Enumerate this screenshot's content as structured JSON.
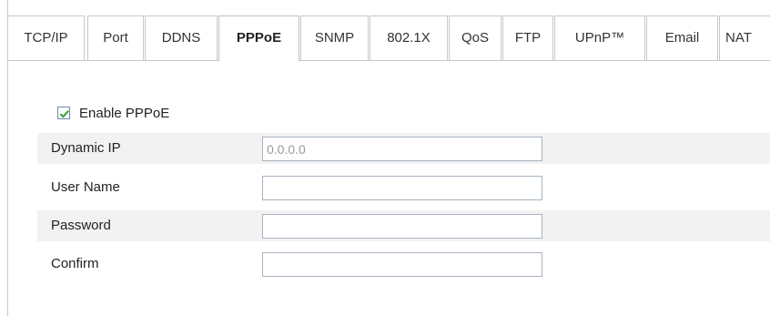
{
  "tabs": [
    {
      "label": "TCP/IP",
      "active": false
    },
    {
      "label": "Port",
      "active": false
    },
    {
      "label": "DDNS",
      "active": false
    },
    {
      "label": "PPPoE",
      "active": true
    },
    {
      "label": "SNMP",
      "active": false
    },
    {
      "label": "802.1X",
      "active": false
    },
    {
      "label": "QoS",
      "active": false
    },
    {
      "label": "FTP",
      "active": false
    },
    {
      "label": "UPnP™",
      "active": false
    },
    {
      "label": "Email",
      "active": false
    },
    {
      "label": "NAT",
      "active": false
    }
  ],
  "enable": {
    "label": "Enable PPPoE",
    "checked": true
  },
  "fields": {
    "dynamic_ip": {
      "label": "Dynamic IP",
      "value": "0.0.0.0"
    },
    "user_name": {
      "label": "User Name",
      "value": ""
    },
    "password": {
      "label": "Password",
      "value": ""
    },
    "confirm": {
      "label": "Confirm",
      "value": ""
    }
  },
  "colors": {
    "check_mark": "#2f9e2f",
    "row_shade": "#f2f2f2",
    "border": "#c8c8c8"
  }
}
